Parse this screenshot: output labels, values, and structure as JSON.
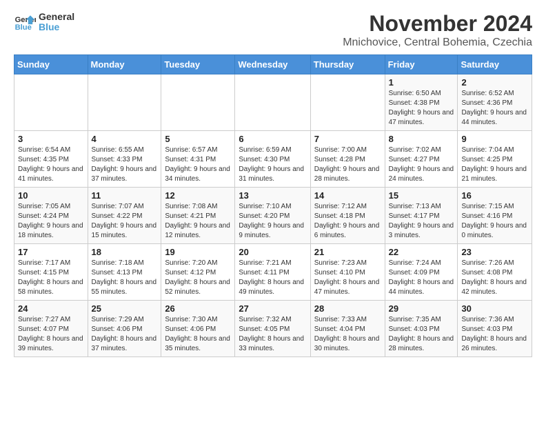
{
  "header": {
    "logo_text_top": "General",
    "logo_text_bottom": "Blue",
    "main_title": "November 2024",
    "sub_title": "Mnichovice, Central Bohemia, Czechia"
  },
  "calendar": {
    "days_of_week": [
      "Sunday",
      "Monday",
      "Tuesday",
      "Wednesday",
      "Thursday",
      "Friday",
      "Saturday"
    ],
    "weeks": [
      [
        {
          "day": "",
          "info": ""
        },
        {
          "day": "",
          "info": ""
        },
        {
          "day": "",
          "info": ""
        },
        {
          "day": "",
          "info": ""
        },
        {
          "day": "",
          "info": ""
        },
        {
          "day": "1",
          "info": "Sunrise: 6:50 AM\nSunset: 4:38 PM\nDaylight: 9 hours and 47 minutes."
        },
        {
          "day": "2",
          "info": "Sunrise: 6:52 AM\nSunset: 4:36 PM\nDaylight: 9 hours and 44 minutes."
        }
      ],
      [
        {
          "day": "3",
          "info": "Sunrise: 6:54 AM\nSunset: 4:35 PM\nDaylight: 9 hours and 41 minutes."
        },
        {
          "day": "4",
          "info": "Sunrise: 6:55 AM\nSunset: 4:33 PM\nDaylight: 9 hours and 37 minutes."
        },
        {
          "day": "5",
          "info": "Sunrise: 6:57 AM\nSunset: 4:31 PM\nDaylight: 9 hours and 34 minutes."
        },
        {
          "day": "6",
          "info": "Sunrise: 6:59 AM\nSunset: 4:30 PM\nDaylight: 9 hours and 31 minutes."
        },
        {
          "day": "7",
          "info": "Sunrise: 7:00 AM\nSunset: 4:28 PM\nDaylight: 9 hours and 28 minutes."
        },
        {
          "day": "8",
          "info": "Sunrise: 7:02 AM\nSunset: 4:27 PM\nDaylight: 9 hours and 24 minutes."
        },
        {
          "day": "9",
          "info": "Sunrise: 7:04 AM\nSunset: 4:25 PM\nDaylight: 9 hours and 21 minutes."
        }
      ],
      [
        {
          "day": "10",
          "info": "Sunrise: 7:05 AM\nSunset: 4:24 PM\nDaylight: 9 hours and 18 minutes."
        },
        {
          "day": "11",
          "info": "Sunrise: 7:07 AM\nSunset: 4:22 PM\nDaylight: 9 hours and 15 minutes."
        },
        {
          "day": "12",
          "info": "Sunrise: 7:08 AM\nSunset: 4:21 PM\nDaylight: 9 hours and 12 minutes."
        },
        {
          "day": "13",
          "info": "Sunrise: 7:10 AM\nSunset: 4:20 PM\nDaylight: 9 hours and 9 minutes."
        },
        {
          "day": "14",
          "info": "Sunrise: 7:12 AM\nSunset: 4:18 PM\nDaylight: 9 hours and 6 minutes."
        },
        {
          "day": "15",
          "info": "Sunrise: 7:13 AM\nSunset: 4:17 PM\nDaylight: 9 hours and 3 minutes."
        },
        {
          "day": "16",
          "info": "Sunrise: 7:15 AM\nSunset: 4:16 PM\nDaylight: 9 hours and 0 minutes."
        }
      ],
      [
        {
          "day": "17",
          "info": "Sunrise: 7:17 AM\nSunset: 4:15 PM\nDaylight: 8 hours and 58 minutes."
        },
        {
          "day": "18",
          "info": "Sunrise: 7:18 AM\nSunset: 4:13 PM\nDaylight: 8 hours and 55 minutes."
        },
        {
          "day": "19",
          "info": "Sunrise: 7:20 AM\nSunset: 4:12 PM\nDaylight: 8 hours and 52 minutes."
        },
        {
          "day": "20",
          "info": "Sunrise: 7:21 AM\nSunset: 4:11 PM\nDaylight: 8 hours and 49 minutes."
        },
        {
          "day": "21",
          "info": "Sunrise: 7:23 AM\nSunset: 4:10 PM\nDaylight: 8 hours and 47 minutes."
        },
        {
          "day": "22",
          "info": "Sunrise: 7:24 AM\nSunset: 4:09 PM\nDaylight: 8 hours and 44 minutes."
        },
        {
          "day": "23",
          "info": "Sunrise: 7:26 AM\nSunset: 4:08 PM\nDaylight: 8 hours and 42 minutes."
        }
      ],
      [
        {
          "day": "24",
          "info": "Sunrise: 7:27 AM\nSunset: 4:07 PM\nDaylight: 8 hours and 39 minutes."
        },
        {
          "day": "25",
          "info": "Sunrise: 7:29 AM\nSunset: 4:06 PM\nDaylight: 8 hours and 37 minutes."
        },
        {
          "day": "26",
          "info": "Sunrise: 7:30 AM\nSunset: 4:06 PM\nDaylight: 8 hours and 35 minutes."
        },
        {
          "day": "27",
          "info": "Sunrise: 7:32 AM\nSunset: 4:05 PM\nDaylight: 8 hours and 33 minutes."
        },
        {
          "day": "28",
          "info": "Sunrise: 7:33 AM\nSunset: 4:04 PM\nDaylight: 8 hours and 30 minutes."
        },
        {
          "day": "29",
          "info": "Sunrise: 7:35 AM\nSunset: 4:03 PM\nDaylight: 8 hours and 28 minutes."
        },
        {
          "day": "30",
          "info": "Sunrise: 7:36 AM\nSunset: 4:03 PM\nDaylight: 8 hours and 26 minutes."
        }
      ]
    ]
  }
}
